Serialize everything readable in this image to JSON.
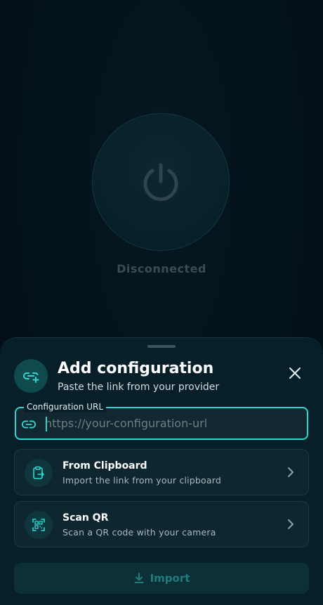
{
  "connection": {
    "status": "Disconnected",
    "icon": "power-icon"
  },
  "sheet": {
    "title": "Add configuration",
    "subtitle": "Paste the link from your provider",
    "header_icon": "link-add-icon",
    "close_icon": "close-icon"
  },
  "url_field": {
    "label": "Configuration URL",
    "placeholder": "https://your-configuration-url",
    "value": "",
    "icon": "link-icon"
  },
  "options": [
    {
      "title": "From Clipboard",
      "description": "Import the link from your clipboard",
      "icon": "clipboard-icon"
    },
    {
      "title": "Scan QR",
      "description": "Scan a QR code with your camera",
      "icon": "qr-scan-icon"
    }
  ],
  "import_button": {
    "label": "Import",
    "icon": "download-icon"
  },
  "colors": {
    "accent": "#2fd6cf",
    "background": "#04121a",
    "sheet": "#071f29",
    "muted": "#3c4b55"
  }
}
